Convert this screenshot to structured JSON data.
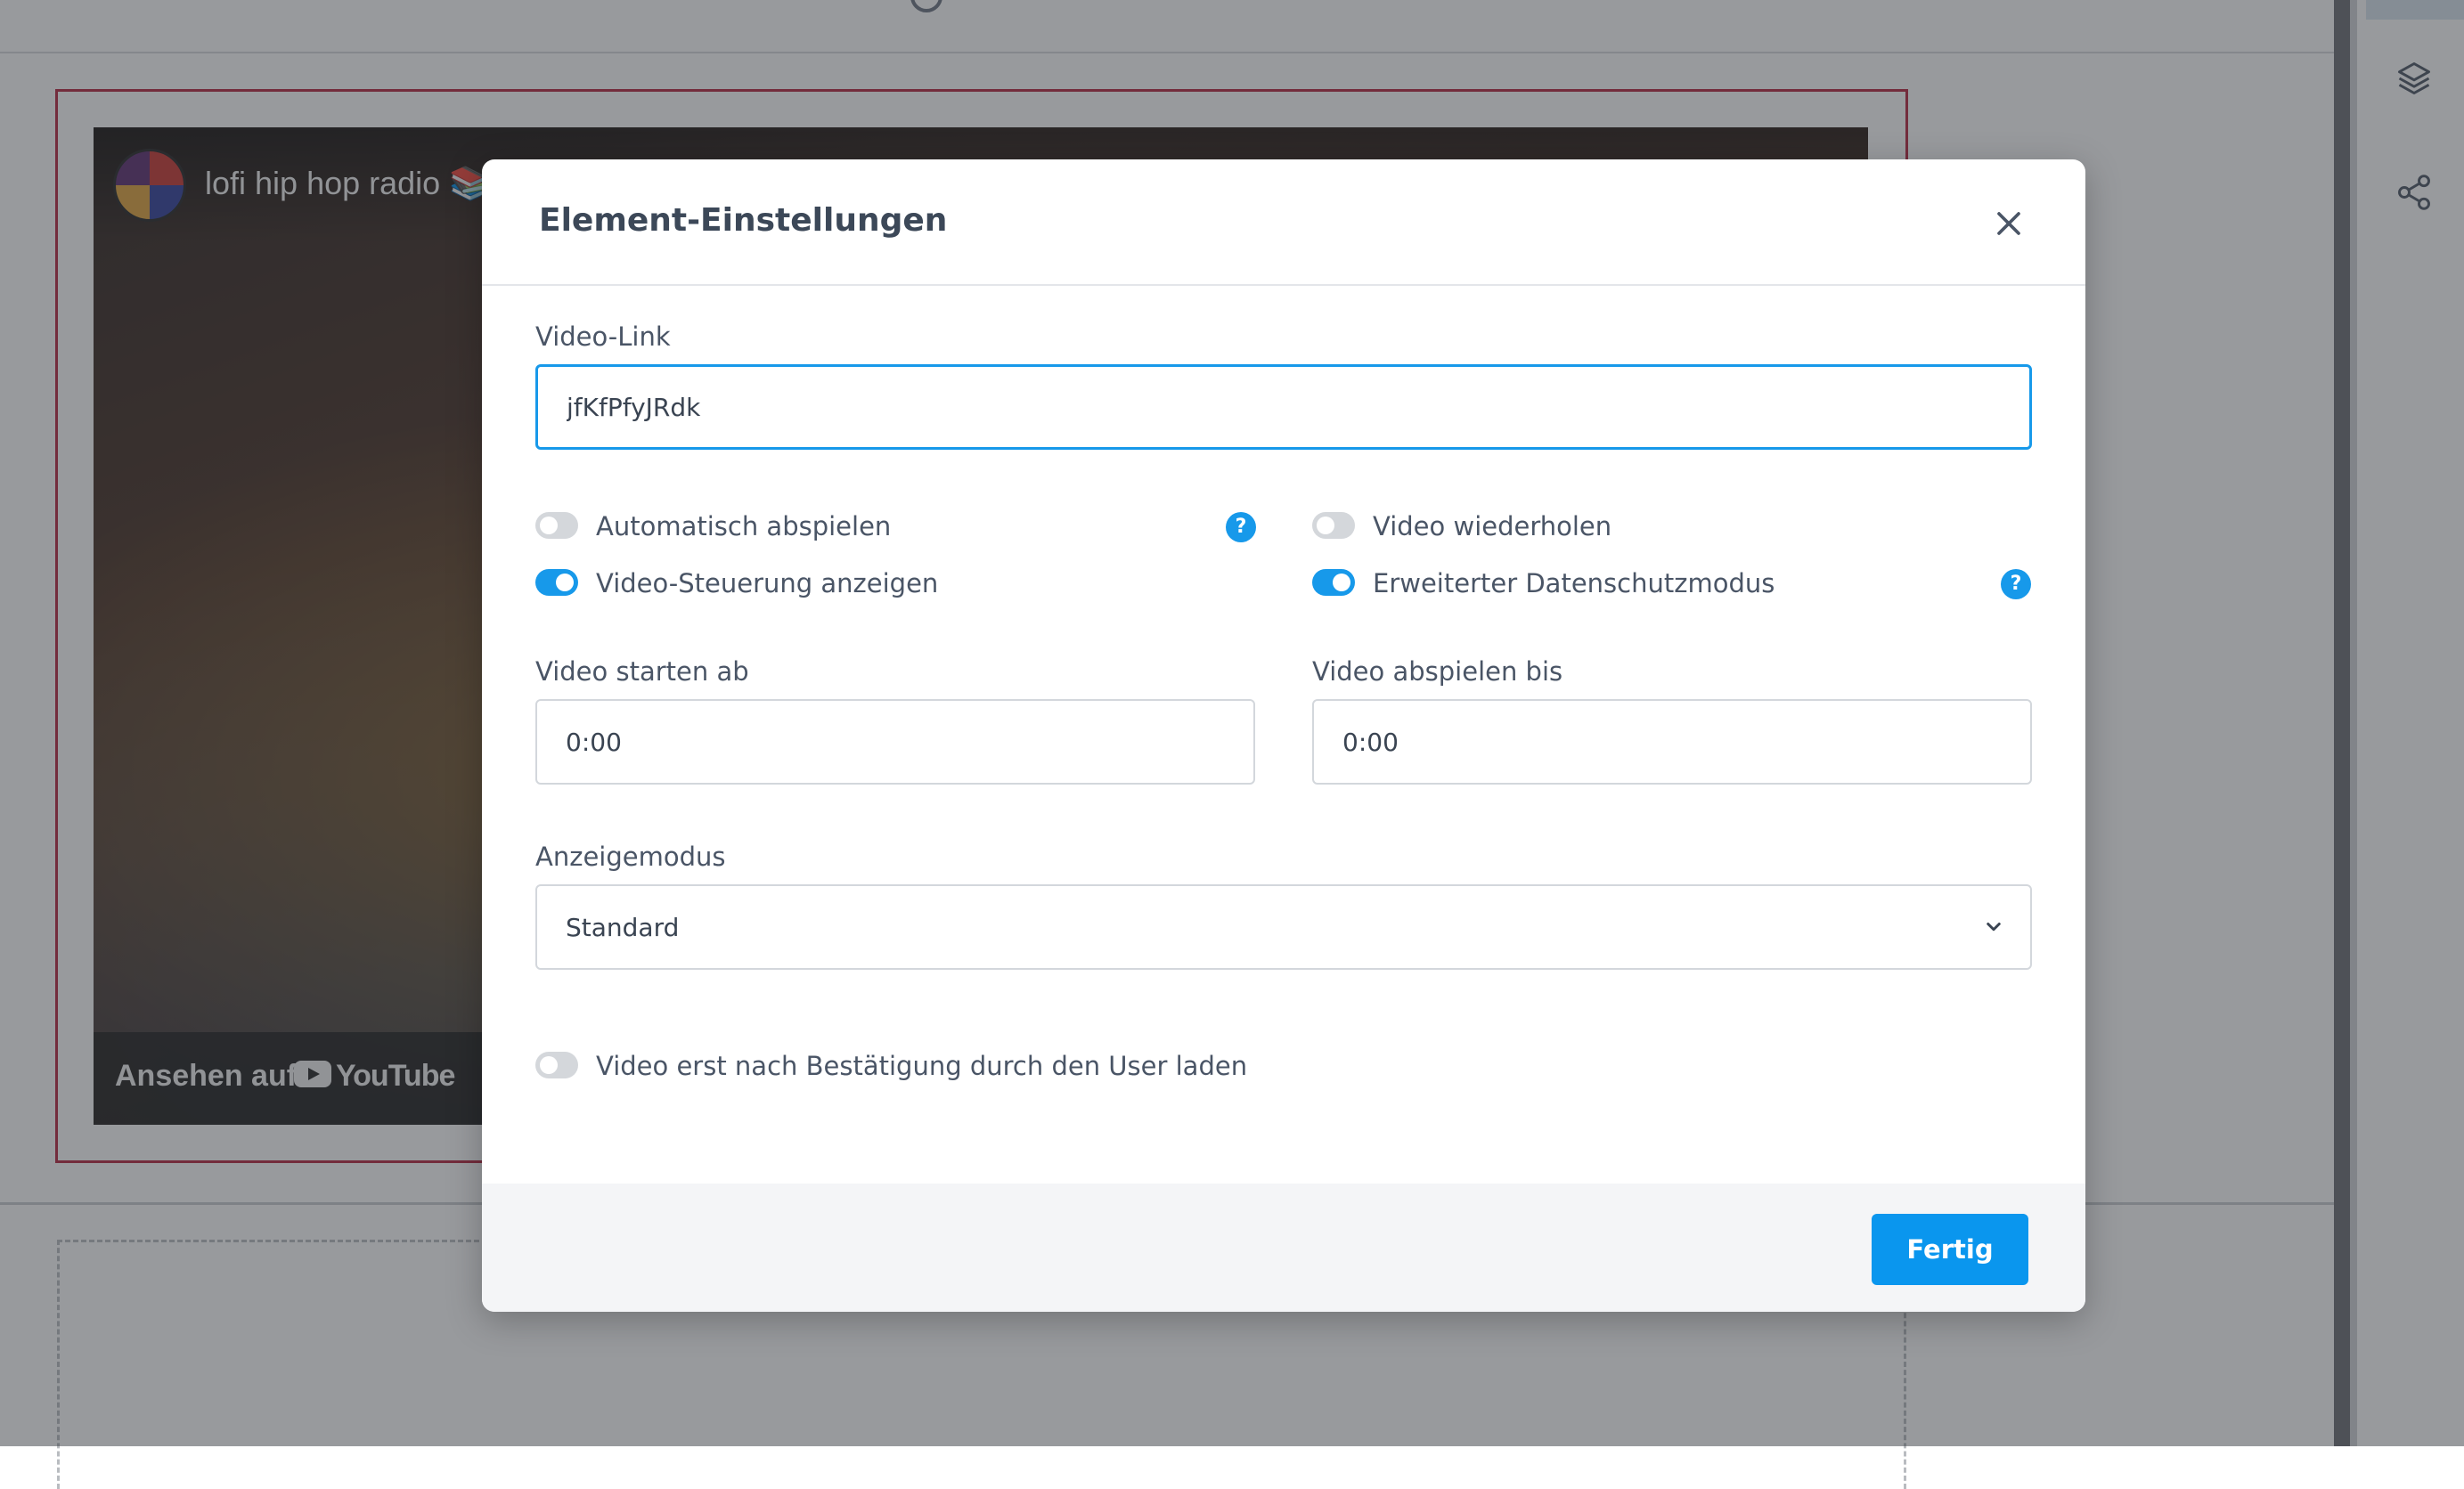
{
  "video_embed": {
    "channel_title": "lofi hip hop radio 📚",
    "watch_on_label": "Ansehen auf",
    "youtube_label": "YouTube"
  },
  "modal": {
    "title": "Element-Einstellungen",
    "close_icon": "close-icon",
    "video_link": {
      "label": "Video-Link",
      "value": "jfKfPfyJRdk"
    },
    "toggles": {
      "autoplay": {
        "label": "Automatisch abspielen",
        "on": false,
        "help": "?"
      },
      "loop": {
        "label": "Video wiederholen",
        "on": false
      },
      "controls": {
        "label": "Video-Steuerung anzeigen",
        "on": true
      },
      "privacy": {
        "label": "Erweiterter Datenschutzmodus",
        "on": true,
        "help": "?"
      },
      "consent": {
        "label": "Video erst nach Bestätigung durch den User laden",
        "on": false
      }
    },
    "start_time": {
      "label": "Video starten ab",
      "value": "0:00"
    },
    "end_time": {
      "label": "Video abspielen bis",
      "value": "0:00"
    },
    "display_mode": {
      "label": "Anzeigemodus",
      "selected": "Standard"
    },
    "done_label": "Fertig"
  },
  "accent_color": "#1799ea"
}
